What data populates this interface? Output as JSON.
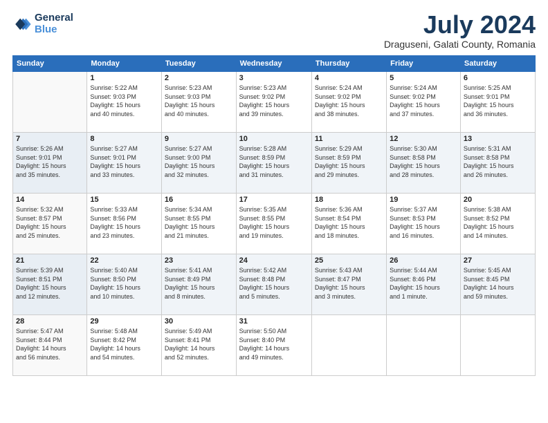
{
  "header": {
    "logo_line1": "General",
    "logo_line2": "Blue",
    "month": "July 2024",
    "location": "Draguseni, Galati County, Romania"
  },
  "days_of_week": [
    "Sunday",
    "Monday",
    "Tuesday",
    "Wednesday",
    "Thursday",
    "Friday",
    "Saturday"
  ],
  "weeks": [
    [
      {
        "day": "",
        "info": ""
      },
      {
        "day": "1",
        "info": "Sunrise: 5:22 AM\nSunset: 9:03 PM\nDaylight: 15 hours\nand 40 minutes."
      },
      {
        "day": "2",
        "info": "Sunrise: 5:23 AM\nSunset: 9:03 PM\nDaylight: 15 hours\nand 40 minutes."
      },
      {
        "day": "3",
        "info": "Sunrise: 5:23 AM\nSunset: 9:02 PM\nDaylight: 15 hours\nand 39 minutes."
      },
      {
        "day": "4",
        "info": "Sunrise: 5:24 AM\nSunset: 9:02 PM\nDaylight: 15 hours\nand 38 minutes."
      },
      {
        "day": "5",
        "info": "Sunrise: 5:24 AM\nSunset: 9:02 PM\nDaylight: 15 hours\nand 37 minutes."
      },
      {
        "day": "6",
        "info": "Sunrise: 5:25 AM\nSunset: 9:01 PM\nDaylight: 15 hours\nand 36 minutes."
      }
    ],
    [
      {
        "day": "7",
        "info": "Sunrise: 5:26 AM\nSunset: 9:01 PM\nDaylight: 15 hours\nand 35 minutes."
      },
      {
        "day": "8",
        "info": "Sunrise: 5:27 AM\nSunset: 9:01 PM\nDaylight: 15 hours\nand 33 minutes."
      },
      {
        "day": "9",
        "info": "Sunrise: 5:27 AM\nSunset: 9:00 PM\nDaylight: 15 hours\nand 32 minutes."
      },
      {
        "day": "10",
        "info": "Sunrise: 5:28 AM\nSunset: 8:59 PM\nDaylight: 15 hours\nand 31 minutes."
      },
      {
        "day": "11",
        "info": "Sunrise: 5:29 AM\nSunset: 8:59 PM\nDaylight: 15 hours\nand 29 minutes."
      },
      {
        "day": "12",
        "info": "Sunrise: 5:30 AM\nSunset: 8:58 PM\nDaylight: 15 hours\nand 28 minutes."
      },
      {
        "day": "13",
        "info": "Sunrise: 5:31 AM\nSunset: 8:58 PM\nDaylight: 15 hours\nand 26 minutes."
      }
    ],
    [
      {
        "day": "14",
        "info": "Sunrise: 5:32 AM\nSunset: 8:57 PM\nDaylight: 15 hours\nand 25 minutes."
      },
      {
        "day": "15",
        "info": "Sunrise: 5:33 AM\nSunset: 8:56 PM\nDaylight: 15 hours\nand 23 minutes."
      },
      {
        "day": "16",
        "info": "Sunrise: 5:34 AM\nSunset: 8:55 PM\nDaylight: 15 hours\nand 21 minutes."
      },
      {
        "day": "17",
        "info": "Sunrise: 5:35 AM\nSunset: 8:55 PM\nDaylight: 15 hours\nand 19 minutes."
      },
      {
        "day": "18",
        "info": "Sunrise: 5:36 AM\nSunset: 8:54 PM\nDaylight: 15 hours\nand 18 minutes."
      },
      {
        "day": "19",
        "info": "Sunrise: 5:37 AM\nSunset: 8:53 PM\nDaylight: 15 hours\nand 16 minutes."
      },
      {
        "day": "20",
        "info": "Sunrise: 5:38 AM\nSunset: 8:52 PM\nDaylight: 15 hours\nand 14 minutes."
      }
    ],
    [
      {
        "day": "21",
        "info": "Sunrise: 5:39 AM\nSunset: 8:51 PM\nDaylight: 15 hours\nand 12 minutes."
      },
      {
        "day": "22",
        "info": "Sunrise: 5:40 AM\nSunset: 8:50 PM\nDaylight: 15 hours\nand 10 minutes."
      },
      {
        "day": "23",
        "info": "Sunrise: 5:41 AM\nSunset: 8:49 PM\nDaylight: 15 hours\nand 8 minutes."
      },
      {
        "day": "24",
        "info": "Sunrise: 5:42 AM\nSunset: 8:48 PM\nDaylight: 15 hours\nand 5 minutes."
      },
      {
        "day": "25",
        "info": "Sunrise: 5:43 AM\nSunset: 8:47 PM\nDaylight: 15 hours\nand 3 minutes."
      },
      {
        "day": "26",
        "info": "Sunrise: 5:44 AM\nSunset: 8:46 PM\nDaylight: 15 hours\nand 1 minute."
      },
      {
        "day": "27",
        "info": "Sunrise: 5:45 AM\nSunset: 8:45 PM\nDaylight: 14 hours\nand 59 minutes."
      }
    ],
    [
      {
        "day": "28",
        "info": "Sunrise: 5:47 AM\nSunset: 8:44 PM\nDaylight: 14 hours\nand 56 minutes."
      },
      {
        "day": "29",
        "info": "Sunrise: 5:48 AM\nSunset: 8:42 PM\nDaylight: 14 hours\nand 54 minutes."
      },
      {
        "day": "30",
        "info": "Sunrise: 5:49 AM\nSunset: 8:41 PM\nDaylight: 14 hours\nand 52 minutes."
      },
      {
        "day": "31",
        "info": "Sunrise: 5:50 AM\nSunset: 8:40 PM\nDaylight: 14 hours\nand 49 minutes."
      },
      {
        "day": "",
        "info": ""
      },
      {
        "day": "",
        "info": ""
      },
      {
        "day": "",
        "info": ""
      }
    ]
  ]
}
